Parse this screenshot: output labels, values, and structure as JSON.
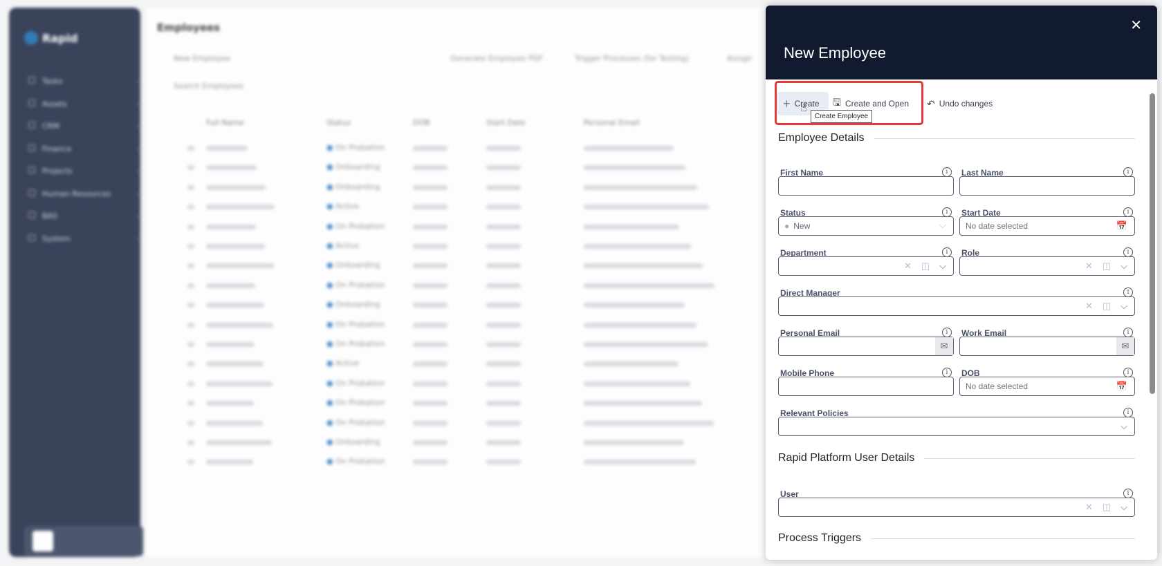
{
  "app": {
    "logo_text": "Rapid",
    "page_title": "Employees"
  },
  "sidebar": {
    "items": [
      {
        "label": "Tasks"
      },
      {
        "label": "Assets"
      },
      {
        "label": "CRM"
      },
      {
        "label": "Finance"
      },
      {
        "label": "Projects"
      },
      {
        "label": "Human Resources"
      },
      {
        "label": "BAS"
      },
      {
        "label": "System"
      }
    ]
  },
  "toolbar": {
    "new": "New Employee",
    "pdf": "Generate Employee PDF",
    "trigger": "Trigger Processes (for Testing)",
    "assign": "Assign",
    "search_placeholder": "Search Employees"
  },
  "table": {
    "headers": [
      "Full Name",
      "Status",
      "DOB",
      "Start Date",
      "Personal Email"
    ],
    "statuses": [
      "On Probation",
      "Onboarding",
      "Onboarding",
      "Active",
      "On Probation",
      "Active",
      "Onboarding",
      "On Probation",
      "Onboarding",
      "On Probation",
      "On Probation",
      "Active",
      "On Probation",
      "On Probation",
      "On Probation",
      "Onboarding",
      "On Probation"
    ]
  },
  "panel": {
    "title": "New Employee",
    "actions": {
      "create": "Create",
      "create_open": "Create and Open",
      "undo": "Undo changes",
      "tooltip": "Create Employee"
    },
    "sections": {
      "details": "Employee Details",
      "user": "Rapid Platform User Details",
      "triggers": "Process Triggers"
    },
    "fields": {
      "first_name": {
        "label": "First Name",
        "value": ""
      },
      "last_name": {
        "label": "Last Name",
        "value": ""
      },
      "status": {
        "label": "Status",
        "value": "New"
      },
      "start_date": {
        "label": "Start Date",
        "placeholder": "No date selected"
      },
      "department": {
        "label": "Department",
        "value": ""
      },
      "role": {
        "label": "Role",
        "value": ""
      },
      "manager": {
        "label": "Direct Manager",
        "value": ""
      },
      "personal_email": {
        "label": "Personal Email",
        "value": ""
      },
      "work_email": {
        "label": "Work Email",
        "value": ""
      },
      "mobile": {
        "label": "Mobile Phone",
        "value": ""
      },
      "dob": {
        "label": "DOB",
        "placeholder": "No date selected"
      },
      "policies": {
        "label": "Relevant Policies",
        "value": ""
      },
      "user": {
        "label": "User",
        "value": ""
      }
    }
  },
  "colors": {
    "header": "#111a2e",
    "highlight": "#e53935",
    "sidebar": "#26304a"
  }
}
